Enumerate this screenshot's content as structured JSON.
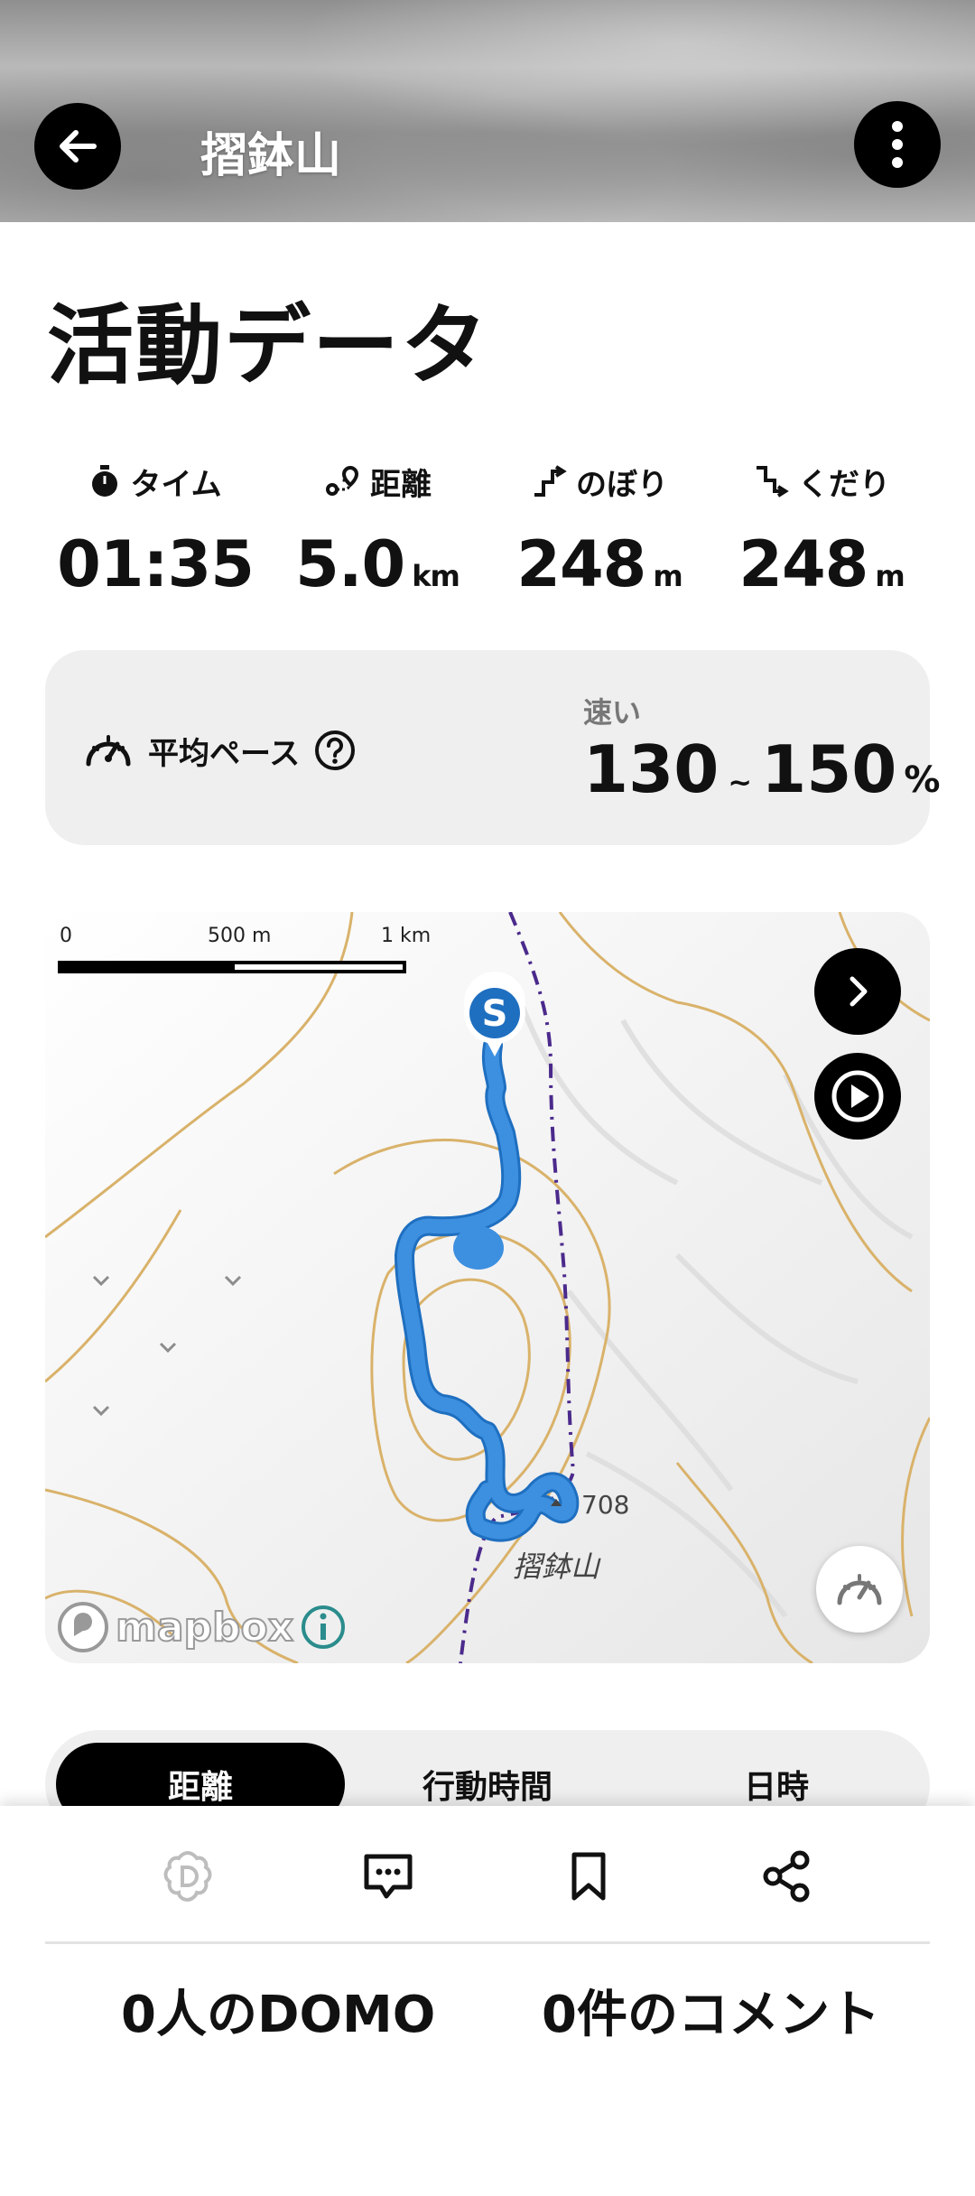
{
  "header": {
    "title": "摺鉢山"
  },
  "section_title": "活動データ",
  "stats": [
    {
      "label": "タイム",
      "value": "01:35",
      "unit": ""
    },
    {
      "label": "距離",
      "value": "5.0",
      "unit": "km"
    },
    {
      "label": "のぼり",
      "value": "248",
      "unit": "m"
    },
    {
      "label": "くだり",
      "value": "248",
      "unit": "m"
    }
  ],
  "pace": {
    "label": "平均ペース",
    "speed_label": "速い",
    "from": "130",
    "tilde": "~",
    "to": "150",
    "unit": "%"
  },
  "map": {
    "scale": {
      "zero": "0",
      "mid": "500 m",
      "end": "1 km"
    },
    "start_marker": "S",
    "peak_elevation": "708",
    "peak_name": "摺鉢山",
    "attribution": "mapbox",
    "route_color": "#3d8fe0",
    "trail_color": "#4b2a8c",
    "contour_color": "#d9b26a"
  },
  "tabs": [
    {
      "label": "距離",
      "active": true
    },
    {
      "label": "行動時間",
      "active": false
    },
    {
      "label": "日時",
      "active": false
    }
  ],
  "actions": [
    "domo-icon",
    "comment-icon",
    "bookmark-icon",
    "share-icon"
  ],
  "counts": {
    "domo": "0人のDOMO",
    "comments": "0件のコメント"
  }
}
